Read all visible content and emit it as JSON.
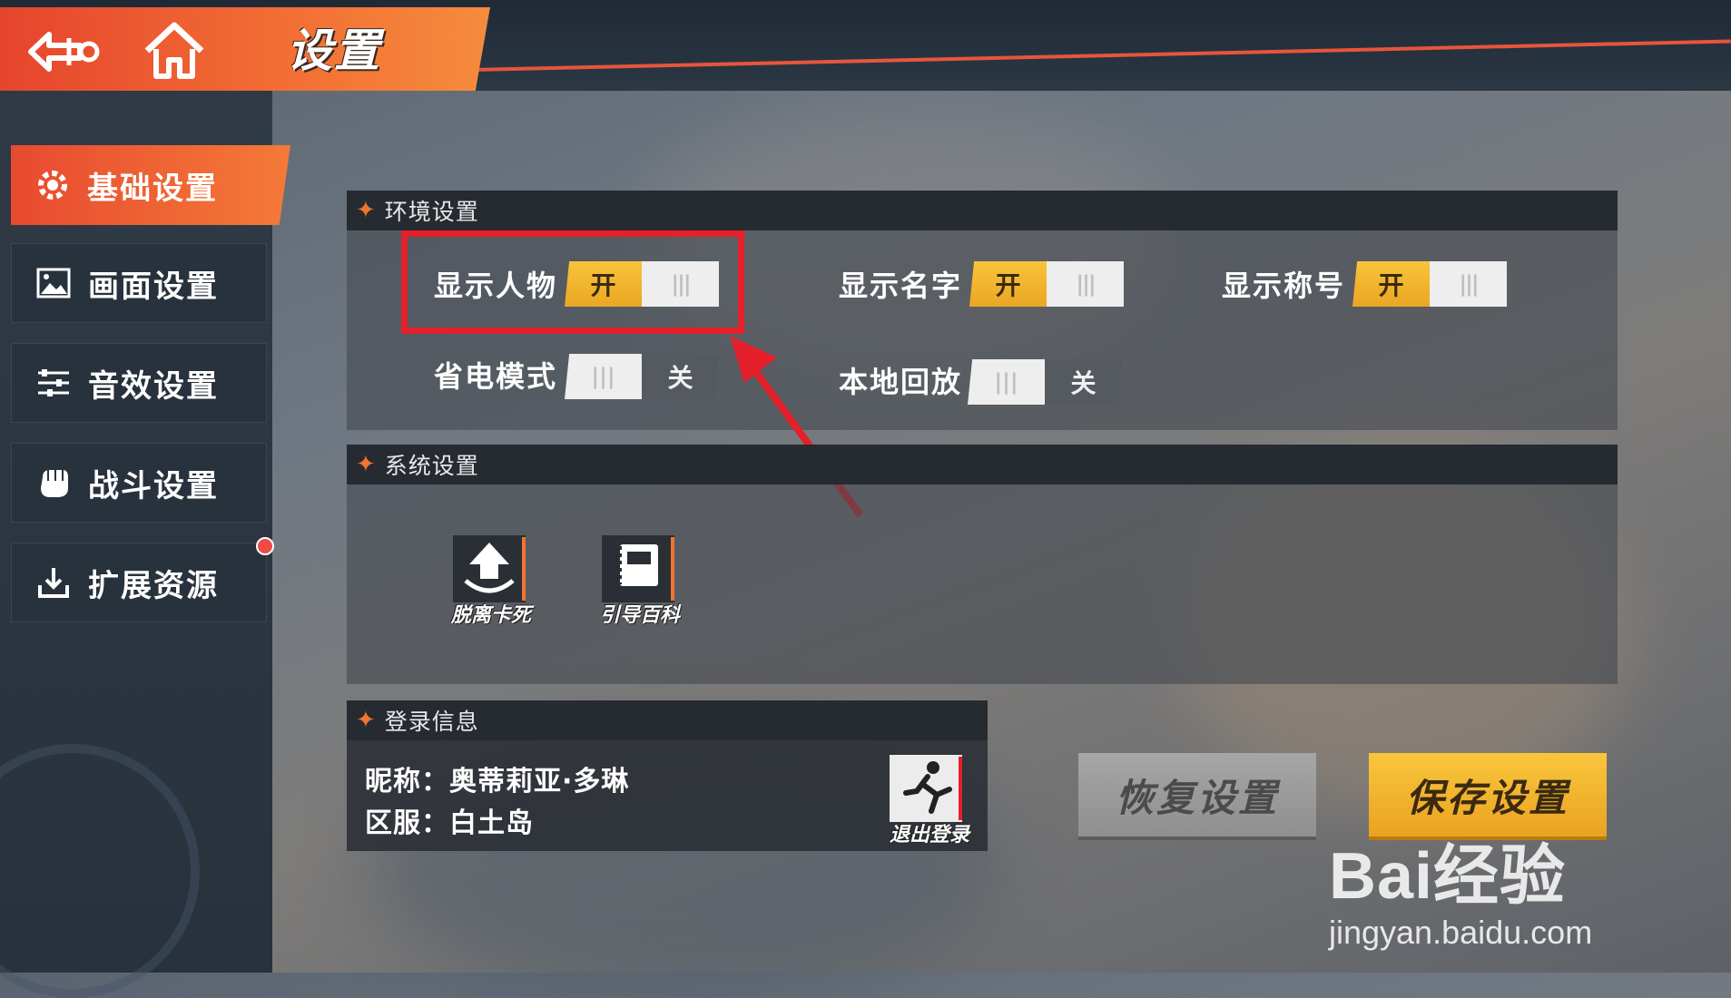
{
  "header": {
    "title": "设置"
  },
  "sidebar": {
    "items": [
      {
        "label": "基础设置",
        "icon": "gear-icon",
        "active": true
      },
      {
        "label": "画面设置",
        "icon": "image-icon",
        "active": false
      },
      {
        "label": "音效设置",
        "icon": "sliders-icon",
        "active": false
      },
      {
        "label": "战斗设置",
        "icon": "fist-icon",
        "active": false
      },
      {
        "label": "扩展资源",
        "icon": "download-icon",
        "active": false
      }
    ]
  },
  "environment": {
    "title": "环境设置",
    "options": [
      {
        "label": "显示人物",
        "state": "开",
        "on": true
      },
      {
        "label": "显示名字",
        "state": "开",
        "on": true
      },
      {
        "label": "显示称号",
        "state": "开",
        "on": true
      },
      {
        "label": "省电模式",
        "state": "关",
        "on": false
      },
      {
        "label": "本地回放",
        "state": "关",
        "on": false
      }
    ],
    "grip": "|||"
  },
  "system": {
    "title": "系统设置",
    "buttons": [
      {
        "label": "脱离卡死",
        "icon": "upload-arrow-icon"
      },
      {
        "label": "引导百科",
        "icon": "book-icon"
      }
    ]
  },
  "login": {
    "title": "登录信息",
    "nickname": "昵称：奥蒂莉亚·多琳",
    "server": "区服：白土岛",
    "logout_label": "退出登录"
  },
  "actions": {
    "restore": "恢复设置",
    "save": "保存设置"
  },
  "watermark": {
    "logo": "Bai经验",
    "url": "jingyan.baidu.com"
  },
  "colors": {
    "accent": "#f3742f",
    "toggle_on": "#f2b52f",
    "highlight": "#e4202a"
  }
}
